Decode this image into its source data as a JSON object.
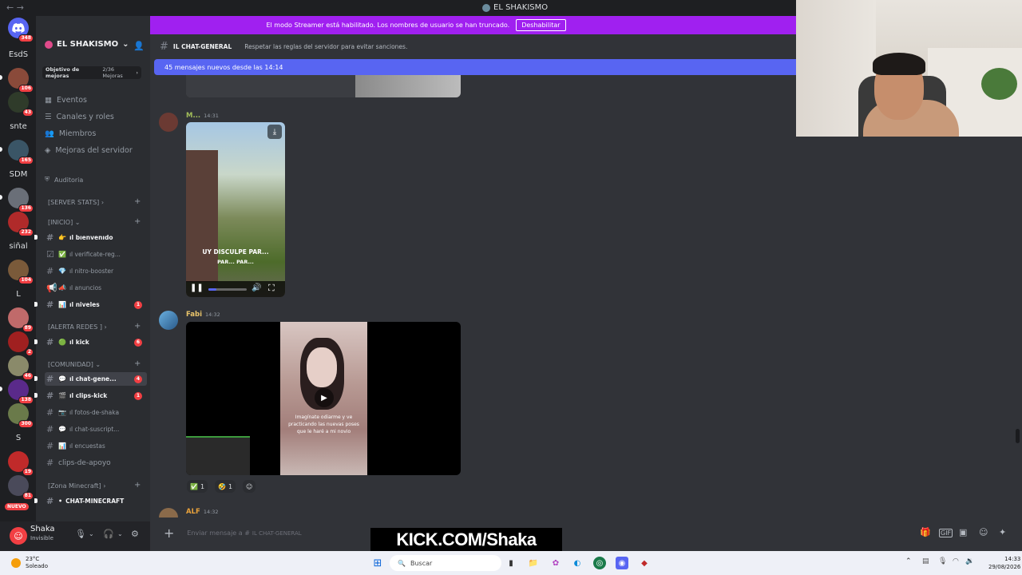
{
  "window": {
    "title": "EL SHAKISMO",
    "nav_back": "←",
    "nav_forward": "→"
  },
  "server_rail": {
    "home_badge": "348",
    "servers": [
      {
        "label": "EsdS",
        "badge": ""
      },
      {
        "label": "",
        "badge": "106"
      },
      {
        "label": "",
        "badge": "43"
      },
      {
        "label": "snte",
        "badge": ""
      },
      {
        "label": "",
        "badge": "165"
      },
      {
        "label": "SDM",
        "badge": ""
      },
      {
        "label": "",
        "badge": "136"
      },
      {
        "label": "",
        "badge": "232"
      },
      {
        "label": "siñal",
        "badge": ""
      },
      {
        "label": "",
        "badge": "104"
      },
      {
        "label": "L",
        "badge": ""
      },
      {
        "label": "",
        "badge": "89"
      },
      {
        "label": "",
        "badge": "2"
      },
      {
        "label": "",
        "badge": "46"
      },
      {
        "label": "",
        "badge": "138"
      },
      {
        "label": "",
        "badge": "300"
      },
      {
        "label": "S",
        "badge": ""
      },
      {
        "label": "",
        "badge": "19"
      },
      {
        "label": "",
        "badge": "81"
      }
    ],
    "new_label": "NUEVO"
  },
  "sidebar": {
    "server_name": "EL SHAKISMO",
    "boost_goal": "Objetivo de mejoras",
    "boost_progress": "2/36 Mejoras",
    "items": [
      {
        "icon": "calendar-icon",
        "label": "Eventos"
      },
      {
        "icon": "channels-icon",
        "label": "Canales y roles"
      },
      {
        "icon": "members-icon",
        "label": "Miembros"
      },
      {
        "icon": "boost-icon",
        "label": "Mejoras del servidor"
      }
    ],
    "audit": "Auditoria",
    "categories": {
      "server_stats": "[SERVER STATS]",
      "inicio": "[INICIO]",
      "alerta_redes": "[ALERTA REDES ]",
      "comunidad": "[COMUNIDAD]",
      "zona_minecraft": "[Zona Minecraft]"
    },
    "channels": {
      "bienvenido": "ıl bıenvenıdo",
      "verificate": "ıl verificate-reg...",
      "nitro": "ıl nitro-booster",
      "anuncios": "ıl anuncios",
      "niveles": "ıl niveles",
      "niveles_count": "1",
      "kick": "ıl kick",
      "kick_count": "6",
      "chat_general": "ıl chat-gene...",
      "chat_general_count": "4",
      "clips_kick": "ıl clips-kick",
      "clips_kick_count": "1",
      "fotos": "ıl fotos-de-shaka",
      "chat_suscript": "ıl chat-suscript...",
      "encuestas": "ıl encuestas",
      "clips_apoyo": "clips-de-apoyo",
      "chat_minecraft": "chat-minecraft"
    }
  },
  "user_panel": {
    "username": "Shaka",
    "status": "Invisible"
  },
  "banner": {
    "text": "El modo Streamer está habilitado. Los nombres de usuario se han truncado.",
    "button": "Deshabilitar"
  },
  "channel_header": {
    "name": "ıl chat-general",
    "topic": "Respetar las reglas del servidor para evitar sanciones."
  },
  "new_messages": "45 mensajes nuevos desde las 14:14",
  "messages": [
    {
      "author": "M...",
      "time": "14:31",
      "author_color": "#a3be5a",
      "video_caption_1": "UY DISCULPE PAR...",
      "video_caption_2": "PAR... PAR..."
    },
    {
      "author": "Fabi",
      "time": "14:32",
      "author_color": "#e9c46a",
      "video_caption": "Imagínate odiarme y ve practicando las nuevas poses que le haré a mi novio",
      "reactions": [
        {
          "emoji": "✅",
          "count": "1"
        },
        {
          "emoji": "🤣",
          "count": "1"
        }
      ]
    },
    {
      "author": "ALF",
      "time": "14:32",
      "author_color": "#e9a23b"
    }
  ],
  "composer": {
    "placeholder": "Enviar mensaje a #",
    "channel": "ıl chat-general"
  },
  "watermark": "KICK.COM/Shaka",
  "taskbar": {
    "temp": "23°C",
    "weather": "Soleado",
    "search": "Buscar",
    "time": "14:33",
    "date": "29/08/2026"
  },
  "colors": {
    "accent": "#5865f2",
    "streamer_banner": "#a020f0",
    "badge": "#f23f43"
  }
}
